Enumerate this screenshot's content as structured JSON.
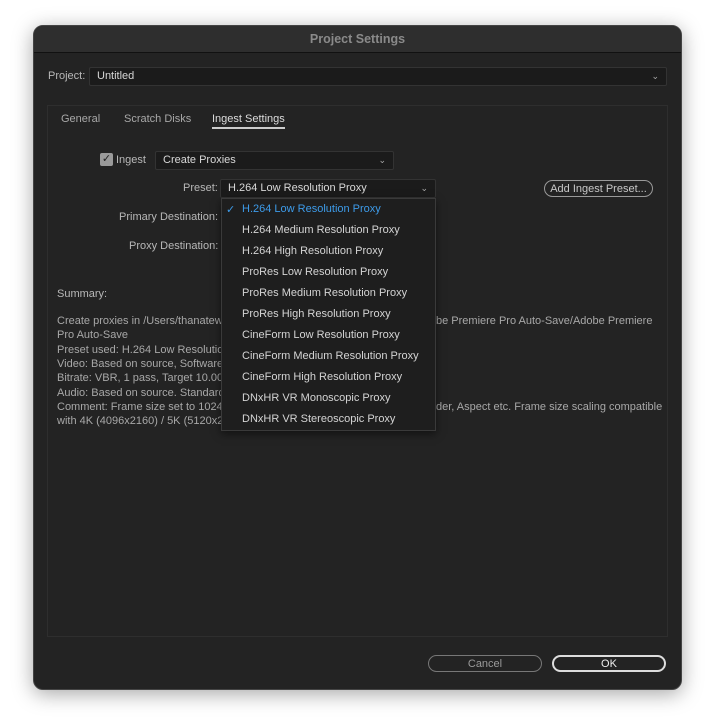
{
  "title": "Project Settings",
  "project": {
    "label": "Project:",
    "value": "Untitled"
  },
  "tabs": [
    "General",
    "Scratch Disks",
    "Ingest Settings"
  ],
  "ingest": {
    "checkbox_label": "Ingest",
    "checked": true,
    "mode": "Create Proxies"
  },
  "preset": {
    "label": "Preset:",
    "value": "H.264 Low Resolution Proxy"
  },
  "add_preset_label": "Add Ingest Preset...",
  "primary_destination_label": "Primary Destination:",
  "proxy_destination_label": "Proxy Destination:",
  "menu_items": [
    "H.264 Low Resolution Proxy",
    "H.264 Medium Resolution Proxy",
    "H.264 High Resolution Proxy",
    "ProRes Low Resolution Proxy",
    "ProRes Medium Resolution Proxy",
    "ProRes High Resolution Proxy",
    "CineForm Low Resolution Proxy",
    "CineForm Medium Resolution Proxy",
    "CineForm High Resolution Proxy",
    "DNxHR VR Monoscopic Proxy",
    "DNxHR VR Stereoscopic Proxy"
  ],
  "summary": {
    "label": "Summary:",
    "left": [
      "Create proxies in /Users/thanatewc",
      "Pro Auto-Save",
      "Preset used: H.264 Low Resolution",
      "Video: Based on source, Software E",
      "Bitrate: VBR, 1 pass, Target 10.00 M",
      "Audio: Based on source. Standard: ",
      "Comment: Frame size set to 1024x",
      "with 4K (4096x2160) / 5K (5120x27"
    ],
    "right": [
      "be Premiere Pro Auto-Save/Adobe Premiere",
      "",
      "",
      "",
      "",
      "",
      "der, Aspect etc. Frame size scaling compatible",
      ""
    ]
  },
  "buttons": {
    "cancel": "Cancel",
    "ok": "OK"
  },
  "accent": "#3d9be9"
}
